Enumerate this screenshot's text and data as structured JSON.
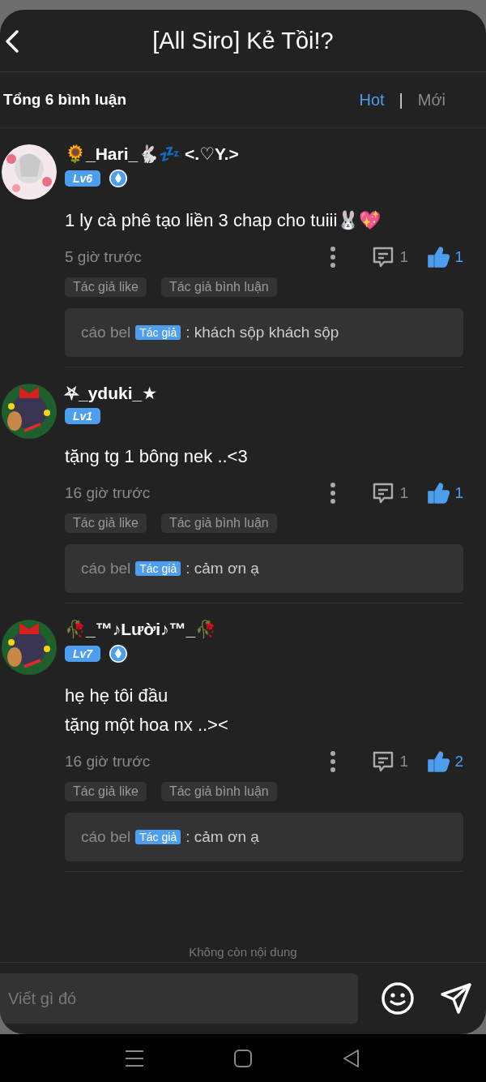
{
  "header": {
    "title": "[All Siro] Kẻ Tồi!?"
  },
  "summary": "Tổng 6 bình luận",
  "sort_tabs": [
    {
      "label": "Hot",
      "selected": true
    },
    {
      "label": "Mới",
      "selected": false
    }
  ],
  "tab_divider": "|",
  "comments": [
    {
      "username": "🌻_Hari_🐇💤 <.♡Y.>",
      "level": "Lv6",
      "author_badge": true,
      "text": "1 ly cà phê tạo liền 3 chap cho tuiii🐰💖",
      "time": "5 giờ trước",
      "reply_count": "1",
      "like_count": "1",
      "liked": true,
      "tags": [
        "Tác giả like",
        "Tác giả bình luận"
      ],
      "replies": [
        {
          "name": "cáo bel",
          "badge": "Tác giả",
          "text": ": khách sộp khách sộp"
        }
      ]
    },
    {
      "username": "⛧_yduki_★",
      "level": "Lv1",
      "author_badge": false,
      "text": "tặng tg 1 bông nek ..<3",
      "time": "16 giờ trước",
      "reply_count": "1",
      "like_count": "1",
      "liked": true,
      "tags": [
        "Tác giả like",
        "Tác giả bình luận"
      ],
      "replies": [
        {
          "name": "cáo bel",
          "badge": "Tác giả",
          "text": ": cảm ơn ạ"
        }
      ]
    },
    {
      "username": "🥀_™♪Lười♪™_🥀",
      "level": "Lv7",
      "author_badge": true,
      "text": "hẹ hẹ tôi đầu\ntặng một hoa nx ..><",
      "time": "16 giờ trước",
      "reply_count": "1",
      "like_count": "2",
      "liked": true,
      "tags": [
        "Tác giả like",
        "Tác giả bình luận"
      ],
      "replies": [
        {
          "name": "cáo bel",
          "badge": "Tác giả",
          "text": ": cảm ơn ạ"
        }
      ]
    }
  ],
  "end_note": "Không còn nội dung",
  "composer": {
    "placeholder": "Viết gì đó"
  }
}
